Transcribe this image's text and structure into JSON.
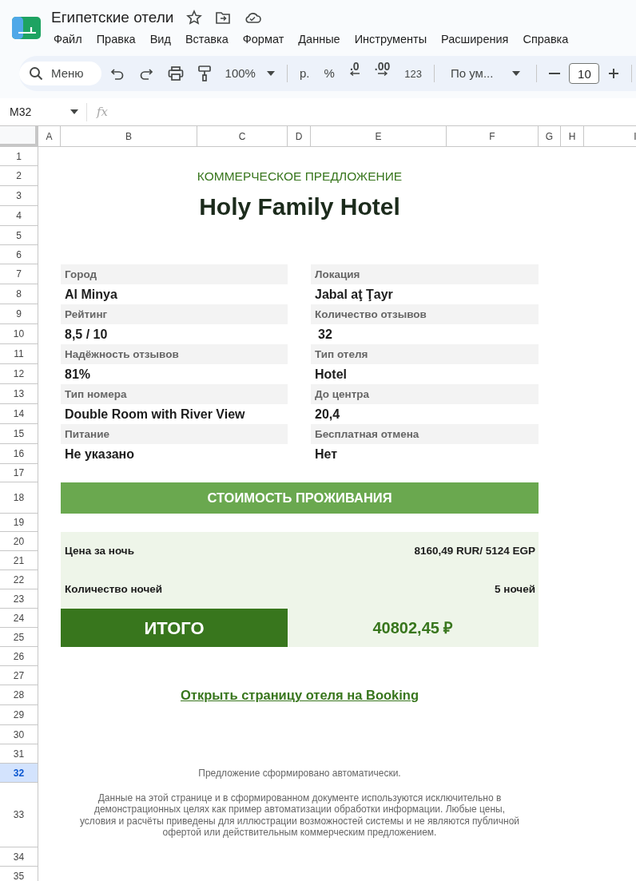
{
  "document": {
    "title": "Египетские отели"
  },
  "menu": [
    "Файл",
    "Правка",
    "Вид",
    "Вставка",
    "Формат",
    "Данные",
    "Инструменты",
    "Расширения",
    "Справка"
  ],
  "toolbar": {
    "search": "Меню",
    "zoom": "100%",
    "currency": "р.",
    "percent": "%",
    "decrease_decimals": ".0",
    "increase_decimals": ".00",
    "number_format": "123",
    "font": "По ум...",
    "font_size": "10"
  },
  "formula_bar": {
    "cell": "M32",
    "fx": "fx"
  },
  "columns": [
    {
      "label": "A",
      "selected": false
    },
    {
      "label": "B",
      "selected": false
    },
    {
      "label": "C",
      "selected": false
    },
    {
      "label": "D",
      "selected": false
    },
    {
      "label": "E",
      "selected": false
    },
    {
      "label": "F",
      "selected": false
    },
    {
      "label": "G",
      "selected": false
    },
    {
      "label": "H",
      "selected": false
    },
    {
      "label": "I",
      "selected": false
    }
  ],
  "rows": [
    {
      "label": "1",
      "selected": false
    },
    {
      "label": "2",
      "selected": false
    },
    {
      "label": "3",
      "selected": false
    },
    {
      "label": "4",
      "selected": false
    },
    {
      "label": "5",
      "selected": false
    },
    {
      "label": "6",
      "selected": false
    },
    {
      "label": "7",
      "selected": false
    },
    {
      "label": "8",
      "selected": false
    },
    {
      "label": "9",
      "selected": false
    },
    {
      "label": "10",
      "selected": false
    },
    {
      "label": "11",
      "selected": false
    },
    {
      "label": "12",
      "selected": false
    },
    {
      "label": "13",
      "selected": false
    },
    {
      "label": "14",
      "selected": false
    },
    {
      "label": "15",
      "selected": false
    },
    {
      "label": "16",
      "selected": false
    },
    {
      "label": "17",
      "selected": false
    },
    {
      "label": "18",
      "selected": false
    },
    {
      "label": "19",
      "selected": false
    },
    {
      "label": "20",
      "selected": false
    },
    {
      "label": "21",
      "selected": false
    },
    {
      "label": "22",
      "selected": false
    },
    {
      "label": "23",
      "selected": false
    },
    {
      "label": "24",
      "selected": false
    },
    {
      "label": "25",
      "selected": false
    },
    {
      "label": "26",
      "selected": false
    },
    {
      "label": "27",
      "selected": false
    },
    {
      "label": "28",
      "selected": false
    },
    {
      "label": "29",
      "selected": false
    },
    {
      "label": "30",
      "selected": false
    },
    {
      "label": "31",
      "selected": false
    },
    {
      "label": "32",
      "selected": true
    },
    {
      "label": "33",
      "selected": false
    },
    {
      "label": "34",
      "selected": false
    },
    {
      "label": "35",
      "selected": false
    }
  ],
  "sheet": {
    "subtitle": "КОММЕРЧЕСКОЕ ПРЕДЛОЖЕНИЕ",
    "title": "Holy Family Hotel",
    "details_left": [
      {
        "label": "Город",
        "value": "Al Minya"
      },
      {
        "label": "Рейтинг",
        "value": "8,5 / 10"
      },
      {
        "label": "Надёжность отзывов",
        "value": "81%"
      },
      {
        "label": "Тип номера",
        "value": "Double Room with River View"
      },
      {
        "label": "Питание",
        "value": "Не указано"
      }
    ],
    "details_right": [
      {
        "label": "Локация",
        "value": "Jabal aţ Ţayr"
      },
      {
        "label": "Количество отзывов",
        "value": "32"
      },
      {
        "label": "Тип отеля",
        "value": "Hotel"
      },
      {
        "label": "До центра",
        "value": "20,4"
      },
      {
        "label": "Бесплатная отмена",
        "value": "Нет"
      }
    ],
    "cost_header": "СТОИМОСТЬ ПРОЖИВАНИЯ",
    "cost_lines": [
      {
        "label": "Цена за ночь",
        "value": "8160,49 RUR/ 5124 EGP"
      },
      {
        "label": "Количество ночей",
        "value": "5 ночей"
      }
    ],
    "total": {
      "label": "ИТОГО",
      "value": "40802,45 ₽"
    },
    "link": "Открыть страницу отеля на Booking",
    "note": "Предложение сформировано автоматически.",
    "disclaimer": "Данные на этой странице и в сформированном документе используются исключительно в демонстрационных целях как пример автоматизации обработки информации. Любые цены, условия и расчёты приведены для иллюстрации возможностей системы и не являются публичной офертой или действительным коммерческим предложением."
  }
}
